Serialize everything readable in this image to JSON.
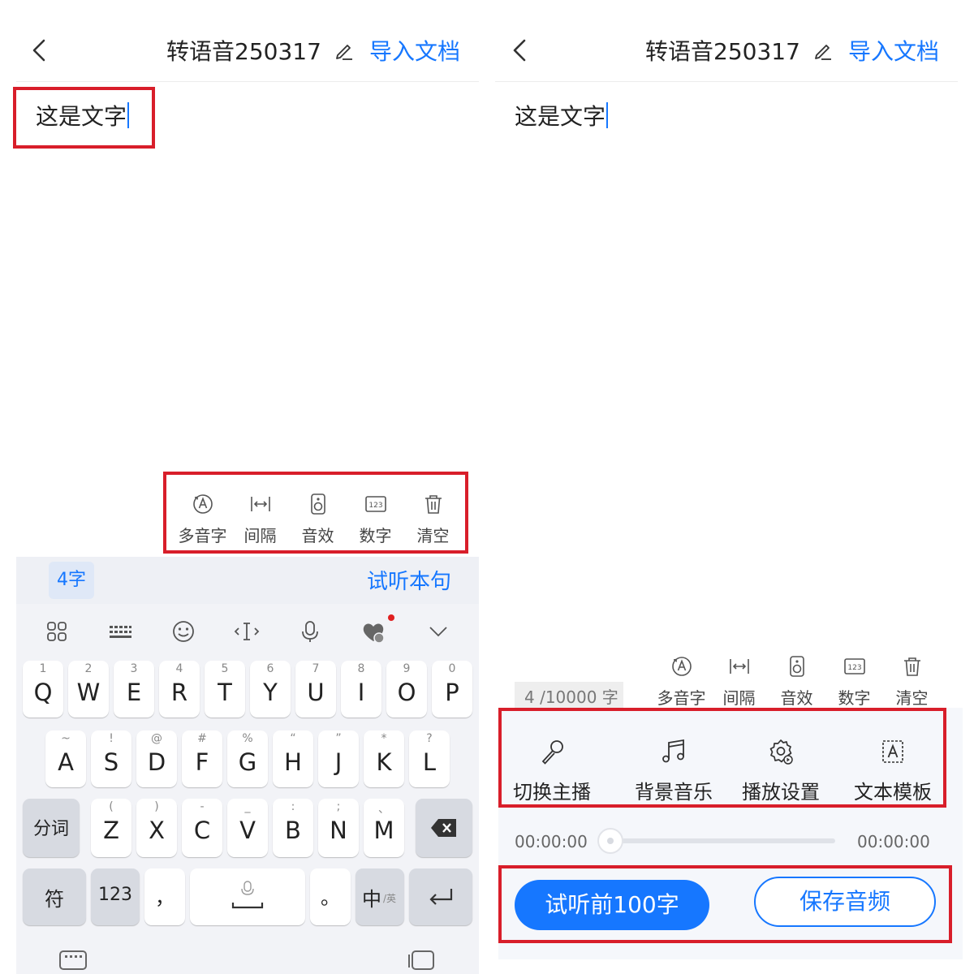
{
  "header": {
    "title": "转语音250317",
    "import_label": "导入文档"
  },
  "editor": {
    "text": "这是文字"
  },
  "tools": [
    {
      "label": "多音字",
      "icon": "polyphone-icon"
    },
    {
      "label": "间隔",
      "icon": "interval-icon"
    },
    {
      "label": "音效",
      "icon": "sound-effect-icon"
    },
    {
      "label": "数字",
      "icon": "number-icon"
    },
    {
      "label": "清空",
      "icon": "trash-icon"
    }
  ],
  "keyboard": {
    "char_count": "4字",
    "listen_label": "试听本句",
    "row1": [
      {
        "label": "Q",
        "sub": "1"
      },
      {
        "label": "W",
        "sub": "2"
      },
      {
        "label": "E",
        "sub": "3"
      },
      {
        "label": "R",
        "sub": "4"
      },
      {
        "label": "T",
        "sub": "5"
      },
      {
        "label": "Y",
        "sub": "6"
      },
      {
        "label": "U",
        "sub": "7"
      },
      {
        "label": "I",
        "sub": "8"
      },
      {
        "label": "O",
        "sub": "9"
      },
      {
        "label": "P",
        "sub": "0"
      }
    ],
    "row2": [
      {
        "label": "A",
        "sub": "~"
      },
      {
        "label": "S",
        "sub": "!"
      },
      {
        "label": "D",
        "sub": "@"
      },
      {
        "label": "F",
        "sub": "#"
      },
      {
        "label": "G",
        "sub": "%"
      },
      {
        "label": "H",
        "sub": "“"
      },
      {
        "label": "J",
        "sub": "”"
      },
      {
        "label": "K",
        "sub": "*"
      },
      {
        "label": "L",
        "sub": "?"
      }
    ],
    "row3": [
      {
        "label": "Z",
        "sub": "("
      },
      {
        "label": "X",
        "sub": ")"
      },
      {
        "label": "C",
        "sub": "-"
      },
      {
        "label": "V",
        "sub": "_"
      },
      {
        "label": "B",
        "sub": ":"
      },
      {
        "label": "N",
        "sub": ";"
      },
      {
        "label": "M",
        "sub": "、"
      }
    ],
    "segment_label": "分词",
    "symbol_label": "符",
    "num_label": "123",
    "comma_label": "，",
    "period_label": "。",
    "lang_label": "中",
    "lang_sub": "/英"
  },
  "right": {
    "counter": "4 /10000 字",
    "functions": [
      {
        "label": "切换主播",
        "icon": "microphone-icon"
      },
      {
        "label": "背景音乐",
        "icon": "music-note-icon"
      },
      {
        "label": "播放设置",
        "icon": "settings-gear-icon"
      },
      {
        "label": "文本模板",
        "icon": "text-template-icon"
      }
    ],
    "time_start": "00:00:00",
    "time_end": "00:00:00",
    "progress": 0,
    "preview_label": "试听前100字",
    "save_label": "保存音频"
  },
  "colors": {
    "accent": "#1677ff",
    "highlight_box": "#d81e2a"
  }
}
